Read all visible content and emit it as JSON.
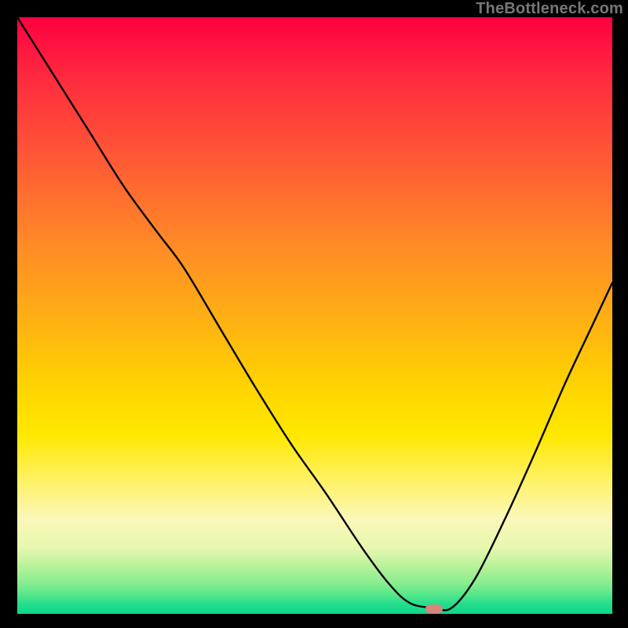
{
  "watermark": "TheBottleneck.com",
  "marker": {
    "x_frac": 0.7,
    "y_frac": 0.991,
    "color": "#d6857c"
  },
  "chart_data": {
    "type": "line",
    "title": "",
    "xlabel": "",
    "ylabel": "",
    "xlim": [
      0,
      1
    ],
    "ylim": [
      0,
      1
    ],
    "x": [
      0.0,
      0.06,
      0.12,
      0.18,
      0.235,
      0.28,
      0.34,
      0.4,
      0.46,
      0.52,
      0.58,
      0.625,
      0.66,
      0.7,
      0.73,
      0.77,
      0.82,
      0.87,
      0.92,
      0.96,
      1.0
    ],
    "y": [
      1.0,
      0.905,
      0.81,
      0.715,
      0.64,
      0.58,
      0.48,
      0.38,
      0.285,
      0.2,
      0.11,
      0.05,
      0.018,
      0.01,
      0.01,
      0.06,
      0.16,
      0.27,
      0.385,
      0.47,
      0.555
    ],
    "series": [
      {
        "name": "bottleneck-curve",
        "color": "#000000"
      }
    ],
    "background_gradient": {
      "top": "#ff0040",
      "mid": "#ffd400",
      "bottom": "#10d68a"
    },
    "minimum_marker_x_frac": 0.7
  }
}
